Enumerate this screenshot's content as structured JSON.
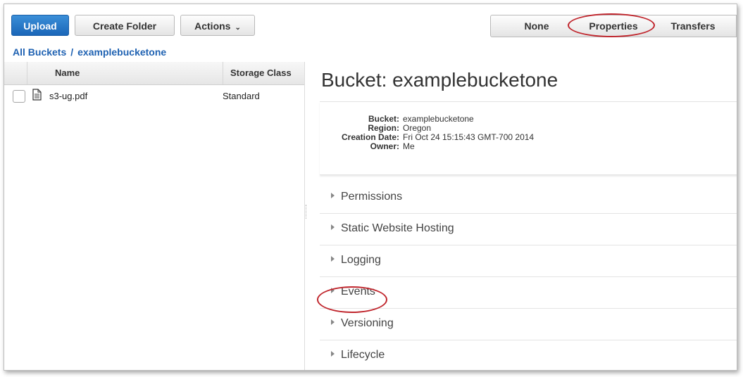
{
  "toolbar": {
    "upload_label": "Upload",
    "create_folder_label": "Create Folder",
    "actions_label": "Actions",
    "view_none_label": "None",
    "view_properties_label": "Properties",
    "view_transfers_label": "Transfers"
  },
  "breadcrumb": {
    "root": "All Buckets",
    "separator": "/",
    "current": "examplebucketone"
  },
  "file_list": {
    "columns": [
      "Name",
      "Storage Class"
    ],
    "rows": [
      {
        "name": "s3-ug.pdf",
        "storage_class": "Standard",
        "icon": "document-icon"
      }
    ]
  },
  "properties": {
    "title": "Bucket: examplebucketone",
    "info": [
      {
        "key": "Bucket:",
        "value": "examplebucketone"
      },
      {
        "key": "Region:",
        "value": "Oregon"
      },
      {
        "key": "Creation Date:",
        "value": "Fri Oct 24 15:15:43 GMT-700 2014"
      },
      {
        "key": "Owner:",
        "value": "Me"
      }
    ],
    "sections": [
      "Permissions",
      "Static Website Hosting",
      "Logging",
      "Events",
      "Versioning",
      "Lifecycle"
    ]
  },
  "colors": {
    "primary_button": "#1a66b8",
    "link": "#1f62b2",
    "highlight_ellipse": "#c0262d"
  }
}
